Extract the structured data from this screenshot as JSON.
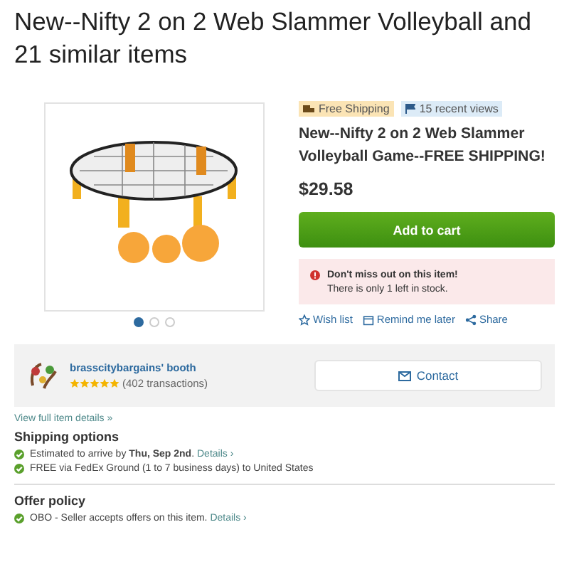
{
  "page_title": "New--Nifty 2 on 2 Web Slammer Volleyball and 21 similar items",
  "gallery": {
    "dots": [
      {
        "selected": true
      },
      {
        "selected": false
      },
      {
        "selected": false
      }
    ]
  },
  "badges": [
    {
      "kind": "shipping",
      "label": "Free Shipping"
    },
    {
      "kind": "views",
      "label": "15 recent views"
    }
  ],
  "product": {
    "title": "New--Nifty 2 on 2 Web Slammer Volleyball Game--FREE SHIPPING!",
    "price": "$29.58",
    "cart_button": "Add to cart"
  },
  "alert": {
    "heading": "Don't miss out on this item!",
    "message": "There is only 1 left in stock."
  },
  "actions": [
    {
      "kind": "wish",
      "label": "Wish list"
    },
    {
      "kind": "remind",
      "label": "Remind me later"
    },
    {
      "kind": "share",
      "label": "Share"
    }
  ],
  "seller": {
    "name": "brasscitybargains' booth",
    "stars": 5,
    "transactions": "(402 transactions)",
    "contact_button": "Contact"
  },
  "details_link": "View full item details »",
  "sections": [
    {
      "heading": "Shipping options",
      "lines": [
        {
          "text": "Estimated to arrive by **Thu, Sep 2nd**.",
          "link": "Details ›"
        },
        {
          "text": "FREE via FedEx Ground (1 to 7 business days) to United States"
        }
      ]
    },
    {
      "heading": "Offer policy",
      "lines": [
        {
          "text": "OBO - Seller accepts offers on this item.",
          "link": "Details ›"
        }
      ]
    }
  ]
}
